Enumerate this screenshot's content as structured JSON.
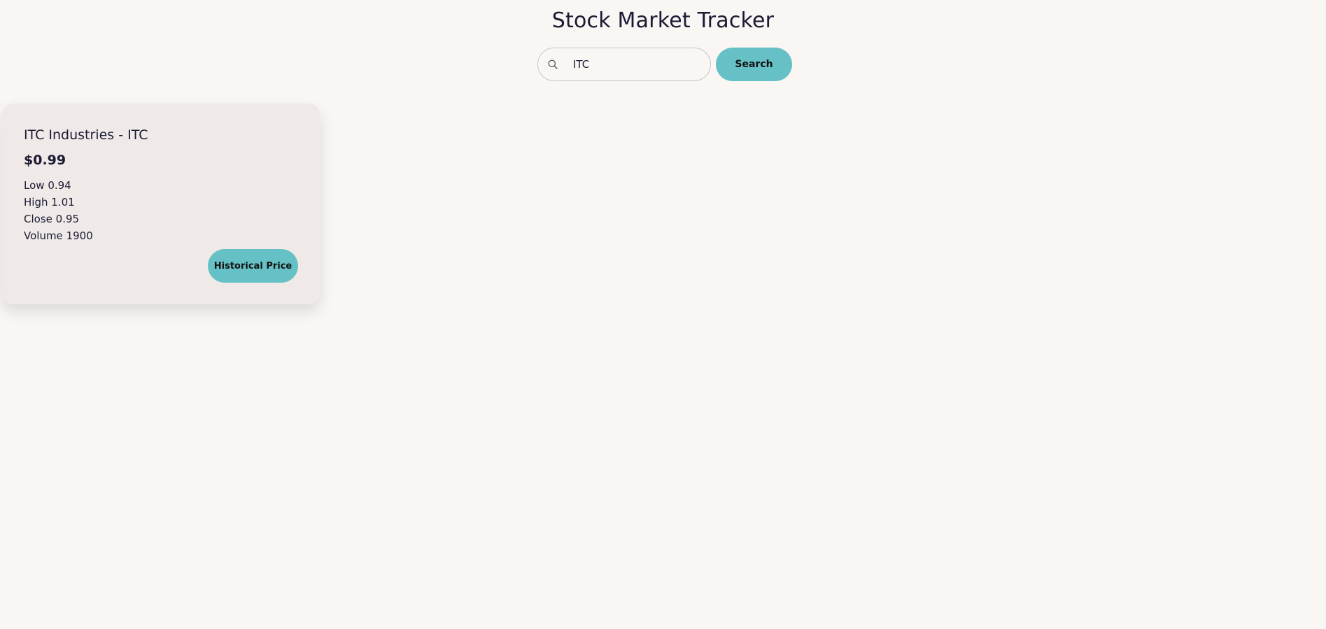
{
  "header": {
    "title": "Stock Market Tracker"
  },
  "search": {
    "value": "ITC",
    "icon": "search-icon",
    "button_label": "Search"
  },
  "stock_card": {
    "name": "ITC Industries - ITC",
    "price": "$0.99",
    "stats": [
      {
        "label": "Low",
        "value": "0.94"
      },
      {
        "label": "High",
        "value": "1.01"
      },
      {
        "label": "Close",
        "value": "0.95"
      },
      {
        "label": "Volume",
        "value": "1900"
      }
    ],
    "button_label": "Historical Price"
  },
  "colors": {
    "background": "#f9f6f4",
    "card": "#efeae7",
    "accent": "#66c1c6",
    "text": "#1c1a33"
  }
}
